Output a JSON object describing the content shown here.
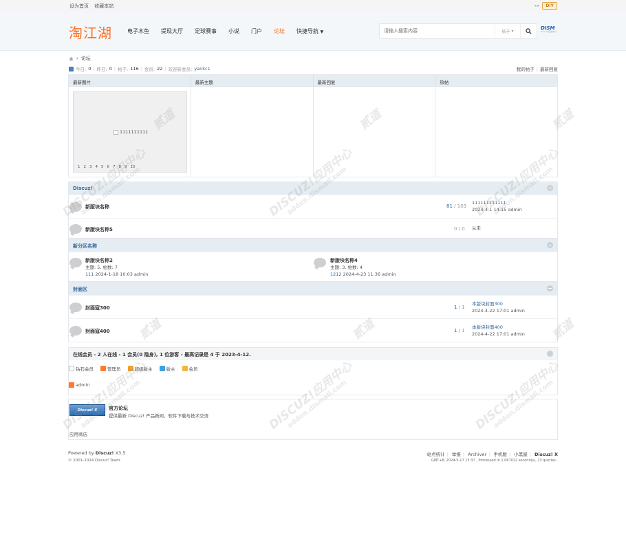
{
  "topbar": {
    "set_home": "设为首页",
    "bookmark": "收藏本站",
    "arrows": "◂ ▸",
    "diy": "DIY"
  },
  "header": {
    "logo": "淘江湖",
    "nav": [
      {
        "label": "电子木鱼"
      },
      {
        "label": "提现大厅"
      },
      {
        "label": "足球赛事"
      },
      {
        "label": "小说"
      },
      {
        "label": "门户"
      },
      {
        "label": "论坛"
      },
      {
        "label": "快捷导航"
      }
    ],
    "search_placeholder": "请输入搜索内容",
    "search_type": "帖子",
    "brand_mini": "DISM",
    "brand_mini_sub": "Discuz!应用中心"
  },
  "breadcrumb": {
    "current": "论坛",
    "sep": "›"
  },
  "stats": {
    "today_label": "今日:",
    "today": "0",
    "yesterday_label": "昨日:",
    "yesterday": "0",
    "posts_label": "帖子:",
    "posts": "116",
    "members_label": "会员:",
    "members": "22",
    "welcome_label": "欢迎新会员:",
    "newest": "yankc1",
    "my_posts": "我的帖子",
    "latest_replies": "最新回复"
  },
  "grid": {
    "headers": [
      "最新图片",
      "最新主题",
      "最新回复",
      "热帖"
    ],
    "image_alt": "1111111111",
    "pages": [
      "1",
      "2",
      "3",
      "4",
      "5",
      "6",
      "7",
      "8",
      "9",
      "10"
    ]
  },
  "cat1": {
    "title": "Discuz!",
    "forums": [
      {
        "name": "新版块名称",
        "threads": "81",
        "posts": "103",
        "last_title": "111111111111",
        "last_meta": "2024-4-1 14:15 admin"
      },
      {
        "name": "新版块名称5",
        "threads": "0",
        "posts": "0",
        "last_title": "",
        "last_meta": "从未"
      }
    ]
  },
  "cat2": {
    "title": "新分区名称",
    "forums": [
      {
        "name": "新版块名称2",
        "stat": "主题: 5, 帖数: 7",
        "last_title": "111",
        "last_meta": "2024-1-18 10:03 admin"
      },
      {
        "name": "新版块名称4",
        "stat": "主题: 3, 帖数: 4",
        "last_title": "1212",
        "last_meta": "2024-4-23 11:36 admin"
      }
    ]
  },
  "cat3": {
    "title": "封面区",
    "forums": [
      {
        "name": "封面寇300",
        "threads": "1",
        "posts": "1",
        "last_title": "本版块封面300",
        "last_meta": "2024-4-22 17:01 admin"
      },
      {
        "name": "封面寇400",
        "threads": "1",
        "posts": "1",
        "last_title": "本版块封面400",
        "last_meta": "2024-4-22 17:01 admin"
      }
    ]
  },
  "online": {
    "title": "在线会员 - 2 人在线 - 1 会员(0 隐身), 1 位游客 - 最高记录是 4 于 2023-4-12.",
    "legend": [
      {
        "label": "钻石会员",
        "color": "#ffffff"
      },
      {
        "label": "管理员",
        "color": "#ff7a2b"
      },
      {
        "label": "超级版主",
        "color": "#f0a22b"
      },
      {
        "label": "版主",
        "color": "#3aa1e0"
      },
      {
        "label": "会员",
        "color": "#f2b63a"
      }
    ],
    "member": "admin"
  },
  "links": {
    "banner": "Discuz! X",
    "title": "官方论坛",
    "desc": "提供最新 Discuz! 产品新闻、软件下载与技术交流",
    "app": "应用商店"
  },
  "footer": {
    "powered_prefix": "Powered by",
    "powered_name": "Discuz!",
    "version": "X3.5",
    "copyright": "© 2001-2024 Discuz! Team.",
    "links": [
      "站点统计",
      "举报",
      "Archiver",
      "手机版",
      "小黑屋"
    ],
    "brand": "Discuz! X",
    "meta": "GMT+8, 2024-5-17 15:37 , Processed in 1.067022 second(s), 23 queries ."
  },
  "watermark": {
    "line1": "DISCUZ!应用中心",
    "line2": "addon.dismall.com",
    "tail": "贰道"
  }
}
